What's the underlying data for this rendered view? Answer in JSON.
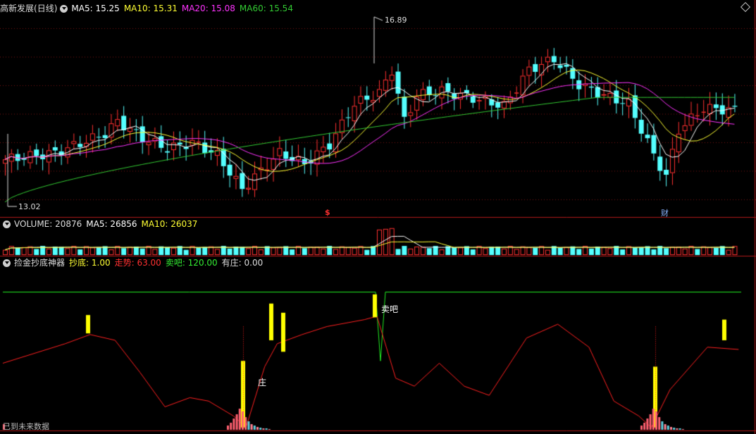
{
  "price_panel": {
    "stock_name": "高新发展",
    "period": "(日线)",
    "ma5": "MA5: 15.25",
    "ma10": "MA10: 15.31",
    "ma20": "MA20: 15.08",
    "ma60": "MA60: 15.54",
    "high_label": "16.89",
    "low_label": "13.02",
    "marker_s": "$",
    "marker_cai": "财"
  },
  "volume_panel": {
    "volume": "VOLUME: 20876",
    "ma5": "MA5: 26856",
    "ma10": "MA10: 26037"
  },
  "indicator_panel": {
    "name": "捡金抄底神器",
    "chaodi": "抄底: 1.00",
    "zoushi": "走势: 63.00",
    "maiba": "卖吧: 120.00",
    "youzhuang": "有庄: 0.00",
    "sell_label": "卖吧",
    "zhuang_label": "庄",
    "footer_text": "已到未来数据"
  },
  "colors": {
    "up": "#ff3030",
    "down": "#54ffff",
    "ma5": "#ffffff",
    "ma10": "#ffff33",
    "ma20": "#ff33ff",
    "ma60": "#33cc33",
    "grid": "#7a1010",
    "divider": "#b01818",
    "signal_bar": "#ffff00",
    "trend_line": "#ff2020",
    "sell_line": "#22ee22"
  },
  "chart_data": {
    "type": "candlestick",
    "title": "高新发展(日线)",
    "price_range": [
      12.8,
      17.5
    ],
    "high": 16.89,
    "low": 13.02,
    "ma_latest": {
      "MA5": 15.25,
      "MA10": 15.31,
      "MA20": 15.08,
      "MA60": 15.54
    },
    "volume_latest": {
      "VOLUME": 20876,
      "MA5": 26856,
      "MA10": 26037
    },
    "indicator_latest": {
      "抄底": 1.0,
      "走势": 63.0,
      "卖吧": 120.0,
      "有庄": 0.0
    },
    "indicator_range": [
      0,
      140
    ]
  }
}
